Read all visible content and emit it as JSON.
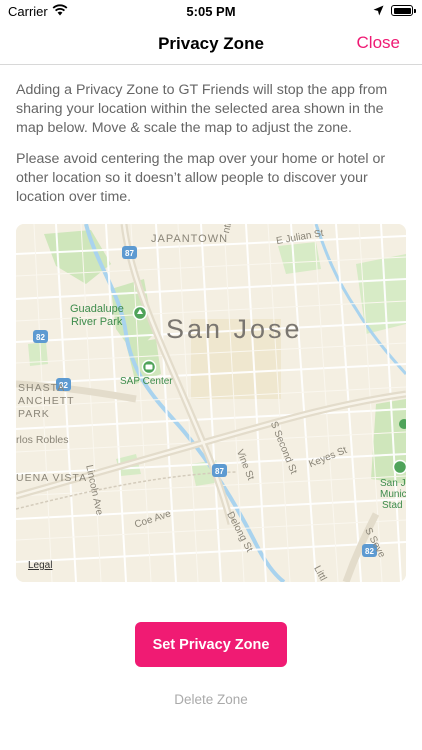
{
  "status_bar": {
    "carrier": "Carrier",
    "time": "5:05 PM",
    "icons": [
      "wifi-icon",
      "location-arrow-icon",
      "battery-icon"
    ]
  },
  "nav": {
    "title": "Privacy Zone",
    "close_label": "Close"
  },
  "content": {
    "paragraph_1": "Adding a Privacy Zone to GT Friends will stop the app from sharing your location within the selected area shown in the map below. Move & scale the map to adjust the zone.",
    "paragraph_2": "Please avoid centering the map over your home or hotel or other location so it doesn’t allow people to discover your location over time."
  },
  "map": {
    "city_label": "San Jose",
    "neighborhoods": {
      "japantown": "JAPANTOWN",
      "shasta_1": "SHASTA",
      "shasta_2": "ANCHETT",
      "shasta_3": "PARK",
      "buena_vista": "UENA VISTA",
      "los_robles": "rlos Robles"
    },
    "places": {
      "park_1": "Guadalupe",
      "park_2": "River Park",
      "arena": "SAP Center",
      "stadium_1": "San J",
      "stadium_2": "Munic",
      "stadium_3": "Stad"
    },
    "streets": {
      "nth_st": "nth St",
      "e_julian": "E Julian St",
      "lincoln": "Lincoln Ave",
      "coe": "Coe Ave",
      "vine": "Vine St",
      "s_second": "S Second St",
      "keyes": "Keyes St",
      "delong": "Delong St",
      "little": "Littl",
      "s_seven": "S Seve"
    },
    "route_shields": [
      "87",
      "82",
      "87",
      "82",
      "82"
    ],
    "legal_label": "Legal",
    "colors": {
      "land": "#f4efe2",
      "park": "#cfe6bb",
      "water": "#a9d3ee",
      "road": "#ffffff",
      "freeway": "#e8e3d5",
      "shield": "#5d9ad1"
    }
  },
  "actions": {
    "set_label": "Set Privacy Zone",
    "delete_label": "Delete Zone",
    "accent": "#f01b73"
  }
}
